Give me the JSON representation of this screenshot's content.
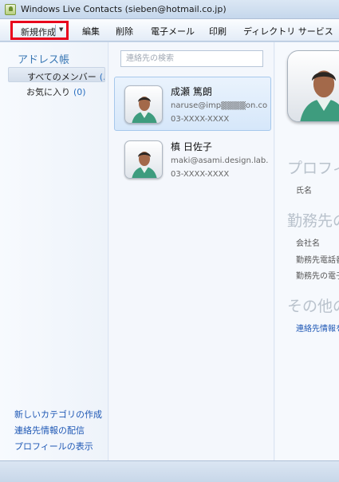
{
  "window": {
    "title": "Windows Live Contacts (sieben@hotmail.co.jp)"
  },
  "menu": {
    "new_label": "新規作成",
    "edit_label": "編集",
    "delete_label": "削除",
    "email_label": "電子メール",
    "print_label": "印刷",
    "directory_label": "ディレクトリ サービス"
  },
  "sidebar": {
    "heading": "アドレス帳",
    "categories": [
      {
        "label": "すべてのメンバー",
        "count": "(.."
      },
      {
        "label": "お気に入り",
        "count": "(0)"
      }
    ],
    "links": {
      "new_category": "新しいカテゴリの作成",
      "publish": "連絡先情報の配信",
      "show_profile": "プロフィールの表示"
    }
  },
  "search": {
    "placeholder": "連絡先の検索"
  },
  "contacts": [
    {
      "name": "成瀬 篤朗",
      "email": "naruse@imp▒▒▒▒on.com",
      "phone": "03-XXXX-XXXX"
    },
    {
      "name": "槙 日佐子",
      "email": "maki@asami.design.lab...",
      "phone": "03-XXXX-XXXX"
    }
  ],
  "detail": {
    "profile_heading": "プロフィ",
    "name_field": "氏名",
    "work_heading": "勤務先の",
    "company_field": "会社名",
    "work_phone_field": "勤務先電話番",
    "work_email_field": "勤務先の電子",
    "other_heading": "その他の",
    "contact_info_link": "連絡先情報を"
  },
  "colors": {
    "highlight_border": "#e8001c",
    "link": "#1f58b5",
    "heading_blue": "#3a78b5",
    "selection": "#d6e7fa"
  }
}
